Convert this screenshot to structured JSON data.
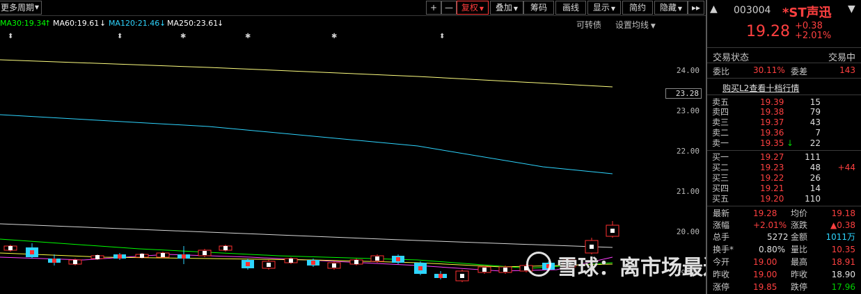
{
  "toolbar": {
    "period": "更多周期",
    "buttons": [
      "+",
      "—",
      "复权",
      "叠加",
      "筹码",
      "画线",
      "显示",
      "简约",
      "隐藏"
    ],
    "expand": "▸▸"
  },
  "ma": {
    "ma30": "MA30:19.34",
    "ma30_dir": "↑",
    "ma60": "MA60:19.61",
    "ma60_dir": "↓",
    "ma120": "MA120:21.46",
    "ma120_dir": "↓",
    "ma250": "MA250:23.61",
    "ma250_dir": "↓",
    "convertible": "可转债",
    "settings": "设置均线"
  },
  "colors": {
    "ma30": "#00ff00",
    "ma60": "#ffffff",
    "ma120": "#2ed5ff",
    "ma250": "#ffff80",
    "up": "#ff3030",
    "down": "#2ed5ff"
  },
  "axis": {
    "labels": [
      "24.00",
      "23.00",
      "22.00",
      "21.00",
      "20.00",
      "19.00"
    ],
    "current_tag": "23.28"
  },
  "chart_data": {
    "type": "candlestick",
    "ylim": [
      18.6,
      24.6
    ],
    "series": [
      {
        "name": "MA250",
        "values": [
          24.3,
          23.95,
          23.6,
          23.5
        ]
      },
      {
        "name": "MA120",
        "values": [
          22.9,
          22.3,
          21.8,
          21.46
        ]
      },
      {
        "name": "MA60",
        "values": [
          20.15,
          19.9,
          19.65,
          19.61
        ]
      },
      {
        "name": "MA30",
        "values": [
          19.9,
          19.6,
          19.2,
          19.34
        ]
      }
    ]
  },
  "quote": {
    "code": "003004",
    "name": "*ST声迅",
    "price": "19.28",
    "change": "+0.38",
    "change_pct": "+2.01%",
    "status_label": "交易状态",
    "status_value": "交易中",
    "weibi_label": "委比",
    "weibi_value": "30.11%",
    "weicha_label": "委差",
    "weicha_value": "143",
    "l2_link": "购买L2查看十档行情",
    "asks": [
      {
        "name": "卖五",
        "price": "19.39",
        "vol": "15"
      },
      {
        "name": "卖四",
        "price": "19.38",
        "vol": "79"
      },
      {
        "name": "卖三",
        "price": "19.37",
        "vol": "43"
      },
      {
        "name": "卖二",
        "price": "19.36",
        "vol": "7"
      },
      {
        "name": "卖一",
        "price": "19.35",
        "vol": "22"
      }
    ],
    "bids": [
      {
        "name": "买一",
        "price": "19.27",
        "vol": "111",
        "extra": ""
      },
      {
        "name": "买二",
        "price": "19.23",
        "vol": "48",
        "extra": "+44"
      },
      {
        "name": "买三",
        "price": "19.22",
        "vol": "26",
        "extra": ""
      },
      {
        "name": "买四",
        "price": "19.21",
        "vol": "14",
        "extra": ""
      },
      {
        "name": "买五",
        "price": "19.20",
        "vol": "110",
        "extra": ""
      }
    ],
    "stats": {
      "latest_label": "最新",
      "latest": "19.28",
      "avg_label": "均价",
      "avg": "19.18",
      "pct_label": "涨幅",
      "pct": "+2.01%",
      "chg_label": "涨跌",
      "chg": "▲0.38",
      "vol_label": "总手",
      "vol": "5272",
      "amt_label": "金额",
      "amt": "1011万",
      "turnover_label": "换手*",
      "turnover": "0.80%",
      "ratio_label": "量比",
      "ratio": "10.35",
      "open_label": "今开",
      "open": "19.00",
      "high_label": "最高",
      "high": "18.91",
      "yclose_label": "昨收",
      "yclose": "18.90",
      "limit_up_label": "涨停",
      "limit_up": "19.85",
      "limit_down_label": "跌停",
      "limit_down": "17.96"
    }
  },
  "watermark": "雪球：离市场最近的兔子"
}
